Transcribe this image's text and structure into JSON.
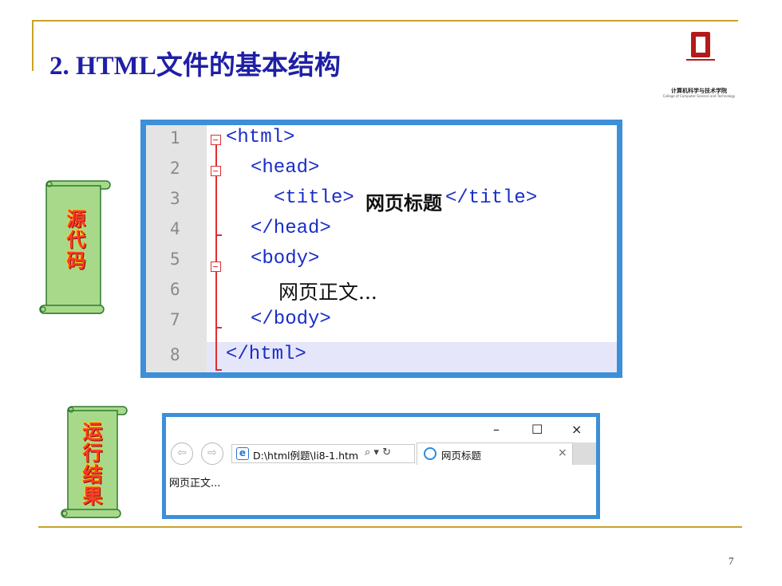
{
  "slide": {
    "title": "2. HTML文件的基本结构",
    "page_number": "7",
    "logo_caption": "计算机科学与技术学院",
    "logo_caption_en": "College of Computer Science and Technology",
    "colors": {
      "title": "#1f1fa6",
      "rule": "#c9a227",
      "frame": "#3d8fd8",
      "scroll": "#a8d98a",
      "label": "#ff3b2f"
    }
  },
  "labels": {
    "source_code": "源代码",
    "run_result": "运行结果"
  },
  "editor": {
    "lines": [
      {
        "num": "1",
        "tag": "<html>"
      },
      {
        "num": "2",
        "tag": "<head>"
      },
      {
        "num": "3",
        "open": "<title>",
        "text": "网页标题",
        "close": "</title>"
      },
      {
        "num": "4",
        "tag": "</head>"
      },
      {
        "num": "5",
        "tag": "<body>"
      },
      {
        "num": "6",
        "text": "网页正文..."
      },
      {
        "num": "7",
        "tag": "</body>"
      },
      {
        "num": "8",
        "tag": "</html>"
      }
    ],
    "highlighted_line": "8"
  },
  "browser": {
    "minimize": "–",
    "maximize": "☐",
    "close": "×",
    "back_icon": "arrow-left-icon",
    "forward_icon": "arrow-right-icon",
    "address": "D:\\html例题\\li8-1.htm",
    "address_tools": "⌕ ▾ ↻",
    "tab_title": "网页标题",
    "tab_close": "×",
    "page_content": "网页正文..."
  }
}
